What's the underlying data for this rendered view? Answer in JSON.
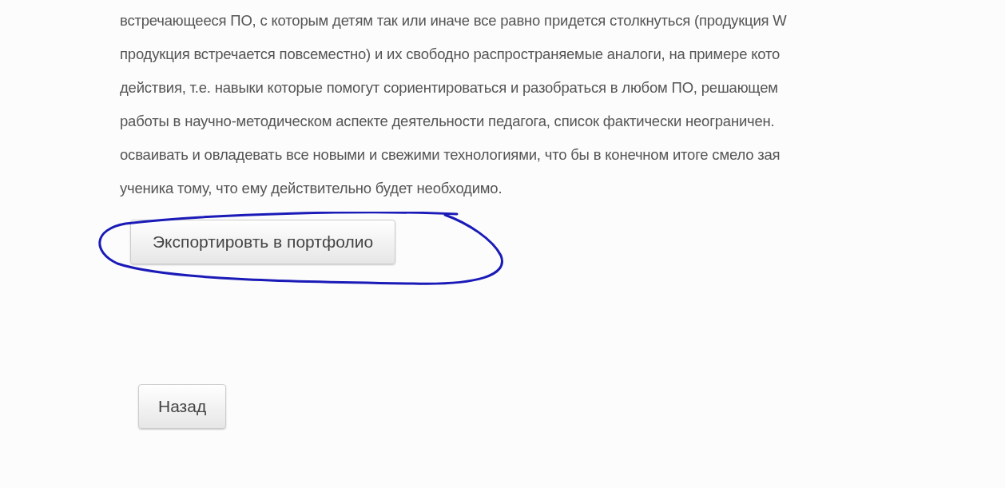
{
  "paragraph_lines": [
    "встречающееся ПО, с которым детям так или иначе все равно придется столкнуться (продукция W",
    "продукция встречается повсеместно) и их свободно распространяемые аналоги, на примере кото",
    "действия, т.е. навыки которые помогут сориентироваться и разобраться в любом ПО, решающем",
    "работы в научно-методическом аспекте деятельности педагога, список фактически неограничен.",
    "осваивать и овладевать все новыми и свежими технологиями, что бы в конечном итоге смело зая",
    "ученика тому, что ему действительно будет необходимо."
  ],
  "export_button": {
    "label": "Экспортировть в портфолио",
    "circled": true
  },
  "back_button": {
    "label": "Назад"
  }
}
